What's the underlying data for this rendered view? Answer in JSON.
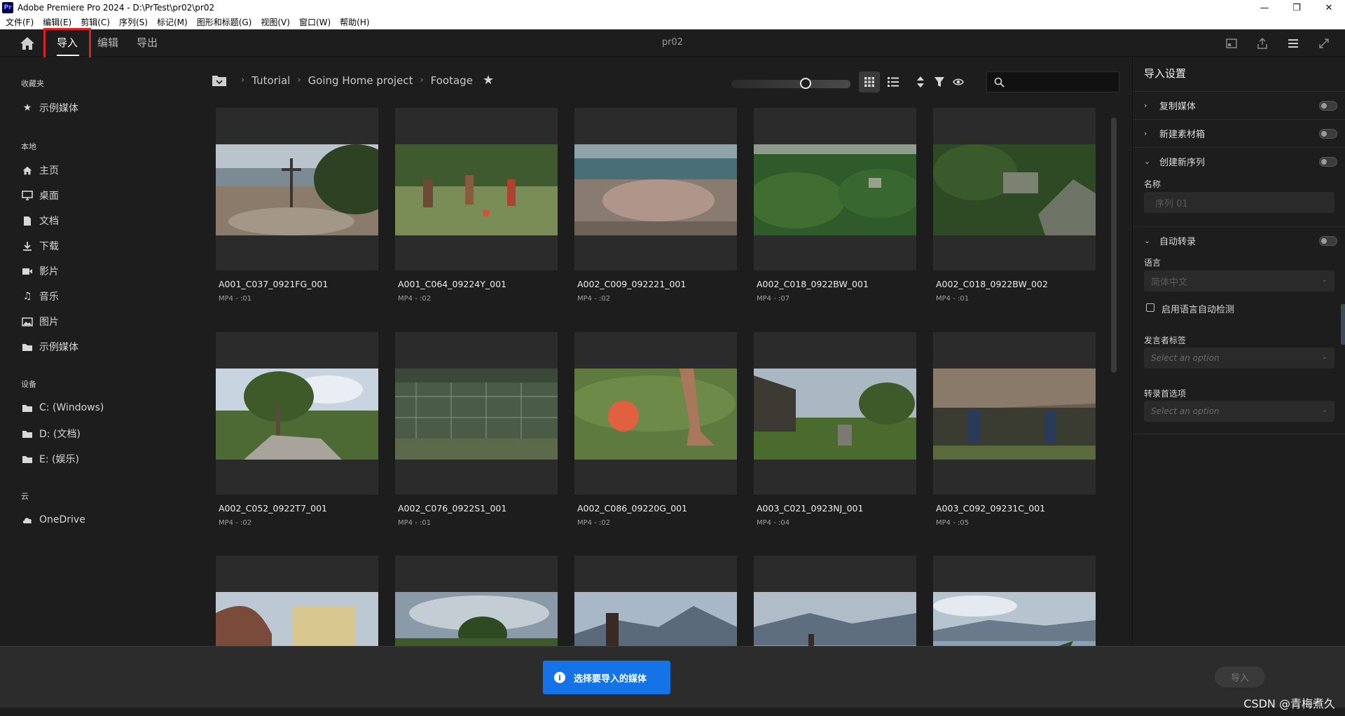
{
  "window": {
    "title": "Adobe Premiere Pro 2024 - D:\\PrTest\\pr02\\pr02",
    "app_icon": "Pr",
    "minimize": "—",
    "maximize": "❐",
    "close": "✕"
  },
  "menu": [
    "文件(F)",
    "编辑(E)",
    "剪辑(C)",
    "序列(S)",
    "标记(M)",
    "图形和标题(G)",
    "视图(V)",
    "窗口(W)",
    "帮助(H)"
  ],
  "header": {
    "tabs": [
      "导入",
      "编辑",
      "导出"
    ],
    "active_tab": "导入",
    "project_title": "pr02"
  },
  "sidebar": {
    "favorites_title": "收藏夹",
    "favorites": [
      {
        "label": "示例媒体",
        "icon": "star-icon"
      }
    ],
    "local_title": "本地",
    "local": [
      {
        "label": "主页",
        "icon": "home-icon"
      },
      {
        "label": "桌面",
        "icon": "desktop-icon"
      },
      {
        "label": "文档",
        "icon": "document-icon"
      },
      {
        "label": "下载",
        "icon": "download-icon"
      },
      {
        "label": "影片",
        "icon": "video-icon"
      },
      {
        "label": "音乐",
        "icon": "music-icon"
      },
      {
        "label": "图片",
        "icon": "image-icon"
      },
      {
        "label": "示例媒体",
        "icon": "folder-icon"
      }
    ],
    "devices_title": "设备",
    "devices": [
      {
        "label": "C: (Windows)",
        "icon": "folder-icon"
      },
      {
        "label": "D: (文档)",
        "icon": "folder-icon"
      },
      {
        "label": "E: (娱乐)",
        "icon": "folder-icon"
      }
    ],
    "cloud_title": "云",
    "cloud": [
      {
        "label": "OneDrive",
        "icon": "cloud-icon"
      }
    ]
  },
  "breadcrumb": [
    "Tutorial",
    "Going Home project",
    "Footage"
  ],
  "media": [
    {
      "name": "A001_C037_0921FG_001",
      "meta": "MP4 - :01"
    },
    {
      "name": "A001_C064_09224Y_001",
      "meta": "MP4 - :02"
    },
    {
      "name": "A002_C009_092221_001",
      "meta": "MP4 - :02"
    },
    {
      "name": "A002_C018_0922BW_001",
      "meta": "MP4 - :07"
    },
    {
      "name": "A002_C018_0922BW_002",
      "meta": "MP4 - :01"
    },
    {
      "name": "A002_C052_0922T7_001",
      "meta": "MP4 - :02"
    },
    {
      "name": "A002_C076_0922S1_001",
      "meta": "MP4 - :01"
    },
    {
      "name": "A002_C086_09220G_001",
      "meta": "MP4 - :02"
    },
    {
      "name": "A003_C021_0923NJ_001",
      "meta": "MP4 - :04"
    },
    {
      "name": "A003_C092_09231C_001",
      "meta": "MP4 - :05"
    },
    {
      "name": "",
      "meta": ""
    },
    {
      "name": "",
      "meta": ""
    },
    {
      "name": "",
      "meta": ""
    },
    {
      "name": "",
      "meta": ""
    },
    {
      "name": "",
      "meta": ""
    }
  ],
  "import_settings": {
    "title": "导入设置",
    "copy_media": "复制媒体",
    "new_bin": "新建素材箱",
    "create_sequence": "创建新序列",
    "name_label": "名称",
    "name_placeholder": "序列 01",
    "auto_transcribe": "自动转录",
    "language_label": "语言",
    "language_value": "简体中文",
    "auto_detect": "启用语言自动检测",
    "speaker_label": "发言者标签",
    "speaker_placeholder": "Select an option",
    "transcribe_pref_label": "转录首选项",
    "transcribe_pref_placeholder": "Select an option"
  },
  "footer": {
    "notice": "选择要导入的媒体",
    "import_button": "导入"
  },
  "watermark": "CSDN @青梅煮久"
}
